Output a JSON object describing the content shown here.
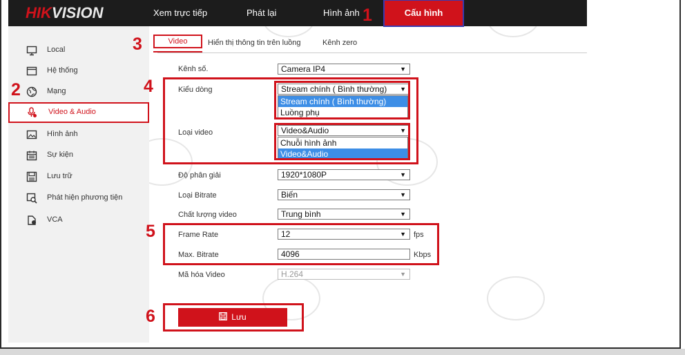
{
  "header": {
    "logo_hik": "HIK",
    "logo_vision": "VISION",
    "nav": [
      "Xem trực tiếp",
      "Phát lại",
      "Hình ảnh"
    ],
    "active_nav": "Cấu hình"
  },
  "markers": [
    "1",
    "2",
    "3",
    "4",
    "5",
    "6"
  ],
  "sidebar": {
    "items": [
      {
        "label": "Local",
        "icon": "monitor-icon"
      },
      {
        "label": "Hệ thống",
        "icon": "system-icon"
      },
      {
        "label": "Mạng",
        "icon": "globe-icon"
      },
      {
        "label": "Video & Audio",
        "icon": "video-audio-icon"
      },
      {
        "label": "Hình ảnh",
        "icon": "image-icon"
      },
      {
        "label": "Sự kiện",
        "icon": "calendar-icon"
      },
      {
        "label": "Lưu trữ",
        "icon": "storage-icon"
      },
      {
        "label": "Phát hiện phương tiện",
        "icon": "vehicle-detection-icon"
      },
      {
        "label": "VCA",
        "icon": "vca-icon"
      }
    ]
  },
  "tabs": [
    "Video",
    "Hiển thị thông tin trên luồng",
    "Kênh zero"
  ],
  "form": {
    "channel": {
      "label": "Kênh số.",
      "value": "Camera IP4"
    },
    "stream_type": {
      "label": "Kiểu dòng",
      "value": "Stream chính ( Bình thường)",
      "options": [
        "Stream chính ( Bình thường)",
        "Luồng phụ"
      ]
    },
    "video_type": {
      "label": "Loại video",
      "value": "Video&Audio",
      "options": [
        "Chuỗi hình ảnh",
        "Video&Audio"
      ]
    },
    "resolution": {
      "label": "Độ phân giải",
      "value": "1920*1080P"
    },
    "bitrate_type": {
      "label": "Loại Bitrate",
      "value": "Biến"
    },
    "video_quality": {
      "label": "Chất lượng video",
      "value": "Trung bình"
    },
    "frame_rate": {
      "label": "Frame Rate",
      "value": "12",
      "unit": "fps"
    },
    "max_bitrate": {
      "label": "Max. Bitrate",
      "value": "4096",
      "unit": "Kbps"
    },
    "video_encoding": {
      "label": "Mã hóa Video",
      "value": "H.264"
    }
  },
  "save_label": "Lưu",
  "colors": {
    "accent": "#d0121b",
    "highlight": "#3d8ee6",
    "topbar": "#1c1c1c"
  }
}
